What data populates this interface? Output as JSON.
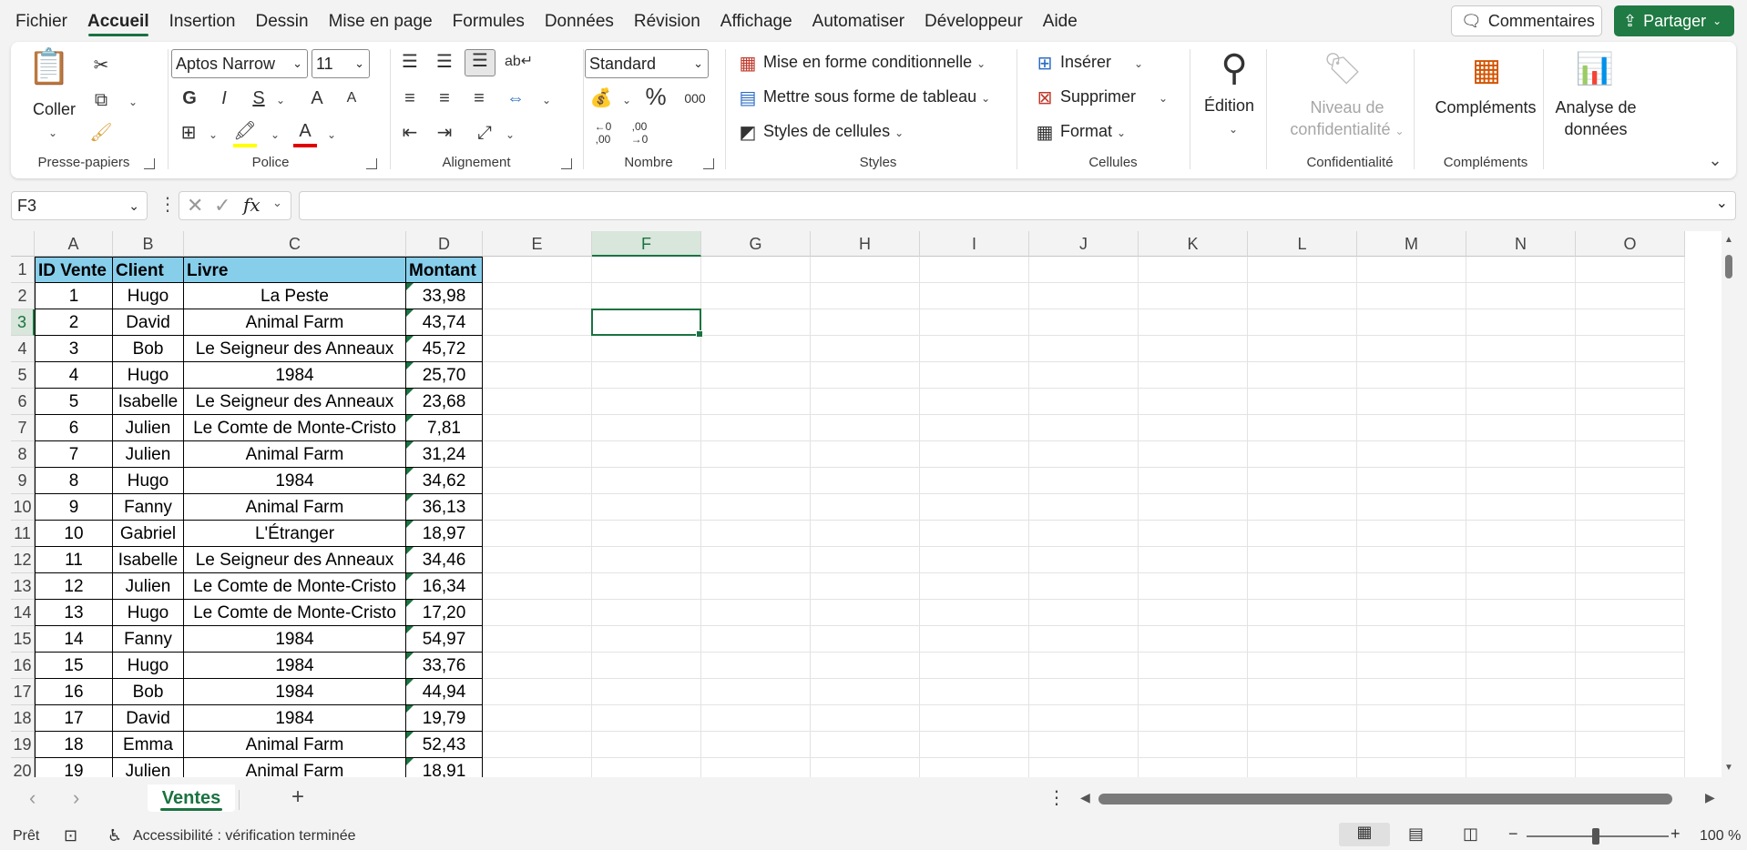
{
  "menu": {
    "items": [
      "Fichier",
      "Accueil",
      "Insertion",
      "Dessin",
      "Mise en page",
      "Formules",
      "Données",
      "Révision",
      "Affichage",
      "Automatiser",
      "Développeur",
      "Aide"
    ],
    "active": "Accueil",
    "comments_label": "Commentaires",
    "share_label": "Partager"
  },
  "ribbon": {
    "clipboard": {
      "paste_label": "Coller",
      "group_label": "Presse-papiers"
    },
    "font": {
      "font_name": "Aptos Narrow",
      "font_size": "11",
      "bold": "G",
      "italic": "I",
      "strike": "S",
      "grow": "A",
      "shrink": "A",
      "font_color_letter": "A",
      "group_label": "Police"
    },
    "alignment": {
      "group_label": "Alignement"
    },
    "number": {
      "format": "Standard",
      "percent": "%",
      "thousands": "000",
      "inc_dec": ",00",
      "dec_dec": ",00",
      "group_label": "Nombre"
    },
    "styles": {
      "conditional": "Mise en forme conditionnelle",
      "as_table": "Mettre sous forme de tableau",
      "cell_styles": "Styles de cellules",
      "group_label": "Styles"
    },
    "cells": {
      "insert": "Insérer",
      "delete": "Supprimer",
      "format": "Format",
      "group_label": "Cellules"
    },
    "editing": {
      "label": "Édition"
    },
    "sensitivity": {
      "label_line1": "Niveau de",
      "label_line2": "confidentialité",
      "group_label": "Confidentialité"
    },
    "addins": {
      "label": "Compléments",
      "group_label": "Compléments"
    },
    "analyze": {
      "label_line1": "Analyse de",
      "label_line2": "données"
    }
  },
  "formula_bar": {
    "name_box": "F3",
    "formula": ""
  },
  "grid": {
    "columns": [
      "A",
      "B",
      "C",
      "D",
      "E",
      "F",
      "G",
      "H",
      "I",
      "J",
      "K",
      "L",
      "M",
      "N",
      "O"
    ],
    "selected_column": "F",
    "selected_row": 3,
    "row_numbers": [
      1,
      2,
      3,
      4,
      5,
      6,
      7,
      8,
      9,
      10,
      11,
      12,
      13,
      14,
      15,
      16,
      17,
      18,
      19,
      20
    ],
    "headers": [
      "ID Vente",
      "Client",
      "Livre",
      "Montant"
    ],
    "header_fill": "#87ceeb",
    "rows": [
      [
        "1",
        "Hugo",
        "La Peste",
        "33,98"
      ],
      [
        "2",
        "David",
        "Animal Farm",
        "43,74"
      ],
      [
        "3",
        "Bob",
        "Le Seigneur des Anneaux",
        "45,72"
      ],
      [
        "4",
        "Hugo",
        "1984",
        "25,70"
      ],
      [
        "5",
        "Isabelle",
        "Le Seigneur des Anneaux",
        "23,68"
      ],
      [
        "6",
        "Julien",
        "Le Comte de Monte-Cristo",
        "7,81"
      ],
      [
        "7",
        "Julien",
        "Animal Farm",
        "31,24"
      ],
      [
        "8",
        "Hugo",
        "1984",
        "34,62"
      ],
      [
        "9",
        "Fanny",
        "Animal Farm",
        "36,13"
      ],
      [
        "10",
        "Gabriel",
        "L'Étranger",
        "18,97"
      ],
      [
        "11",
        "Isabelle",
        "Le Seigneur des Anneaux",
        "34,46"
      ],
      [
        "12",
        "Julien",
        "Le Comte de Monte-Cristo",
        "16,34"
      ],
      [
        "13",
        "Hugo",
        "Le Comte de Monte-Cristo",
        "17,20"
      ],
      [
        "14",
        "Fanny",
        "1984",
        "54,97"
      ],
      [
        "15",
        "Hugo",
        "1984",
        "33,76"
      ],
      [
        "16",
        "Bob",
        "1984",
        "44,94"
      ],
      [
        "17",
        "David",
        "1984",
        "19,79"
      ],
      [
        "18",
        "Emma",
        "Animal Farm",
        "52,43"
      ],
      [
        "19",
        "Julien",
        "Animal Farm",
        "18,91"
      ]
    ]
  },
  "sheets": {
    "active": "Ventes",
    "add": "+"
  },
  "status": {
    "ready": "Prêt",
    "accessibility": "Accessibilité : vérification terminée",
    "zoom": "100 %"
  },
  "colors": {
    "accent": "#1a7340",
    "share_bg": "#1f7a43"
  }
}
